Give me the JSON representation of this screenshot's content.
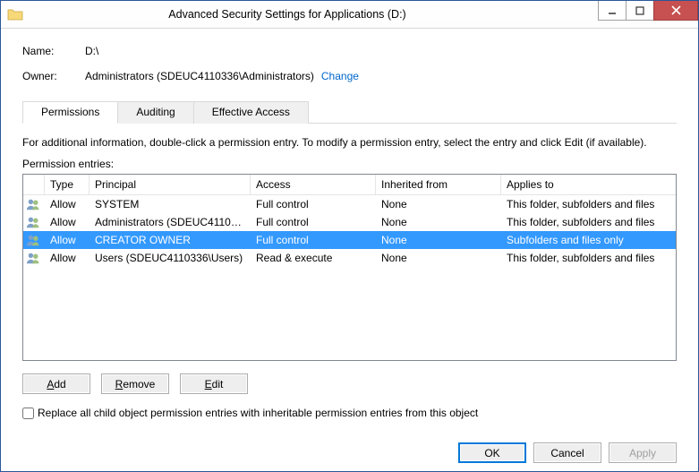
{
  "window": {
    "title": "Advanced Security Settings for Applications (D:)"
  },
  "fields": {
    "name_label": "Name:",
    "name_value": "D:\\",
    "owner_label": "Owner:",
    "owner_value": "Administrators (SDEUC4110336\\Administrators)",
    "change_link": "Change"
  },
  "tabs": {
    "permissions": "Permissions",
    "auditing": "Auditing",
    "effective": "Effective Access",
    "active": "permissions"
  },
  "instruction": "For additional information, double-click a permission entry. To modify a permission entry, select the entry and click Edit (if available).",
  "entries_label": "Permission entries:",
  "columns": {
    "type": "Type",
    "principal": "Principal",
    "access": "Access",
    "inherited": "Inherited from",
    "applies": "Applies to"
  },
  "rows": [
    {
      "type": "Allow",
      "principal": "SYSTEM",
      "access": "Full control",
      "inherited": "None",
      "applies": "This folder, subfolders and files",
      "selected": false
    },
    {
      "type": "Allow",
      "principal": "Administrators (SDEUC411033...",
      "access": "Full control",
      "inherited": "None",
      "applies": "This folder, subfolders and files",
      "selected": false
    },
    {
      "type": "Allow",
      "principal": "CREATOR OWNER",
      "access": "Full control",
      "inherited": "None",
      "applies": "Subfolders and files only",
      "selected": true
    },
    {
      "type": "Allow",
      "principal": "Users (SDEUC4110336\\Users)",
      "access": "Read & execute",
      "inherited": "None",
      "applies": "This folder, subfolders and files",
      "selected": false
    }
  ],
  "buttons": {
    "add": "Add",
    "remove": "Remove",
    "edit": "Edit",
    "ok": "OK",
    "cancel": "Cancel",
    "apply": "Apply"
  },
  "checkbox": {
    "label": "Replace all child object permission entries with inheritable permission entries from this object",
    "checked": false
  }
}
